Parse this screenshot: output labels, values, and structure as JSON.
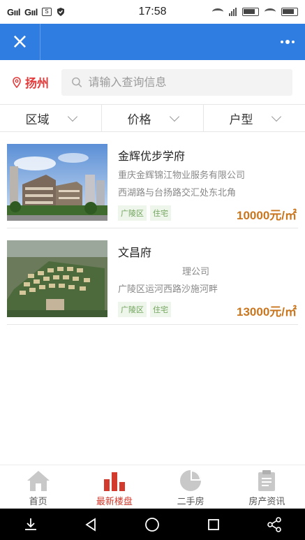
{
  "status_bar": {
    "left": "G",
    "time": "17:58"
  },
  "header": {
    "close_label": "×"
  },
  "search": {
    "city": "扬州",
    "placeholder": "请输入查询信息"
  },
  "filters": [
    {
      "label": "区域"
    },
    {
      "label": "价格"
    },
    {
      "label": "户型"
    }
  ],
  "listings": [
    {
      "title": "金辉优步学府",
      "developer": "重庆金辉锦江物业服务有限公司",
      "address": "西湖路与台扬路交汇处东北角",
      "tags": [
        "广陵区",
        "住宅"
      ],
      "price": "10000元/㎡"
    },
    {
      "title": "文昌府",
      "developer": "理公司",
      "address": "广陵区运河西路沙施河畔",
      "tags": [
        "广陵区",
        "住宅"
      ],
      "price": "13000元/㎡"
    }
  ],
  "tabbar": {
    "items": [
      {
        "label": "首页",
        "icon": "home-icon"
      },
      {
        "label": "最新楼盘",
        "icon": "bar-chart-icon"
      },
      {
        "label": "二手房",
        "icon": "pie-chart-icon"
      },
      {
        "label": "房产资讯",
        "icon": "clipboard-icon"
      }
    ],
    "active_index": 1
  },
  "colors": {
    "header_blue": "#2f7de1",
    "city_red": "#e23b3b",
    "price_orange": "#c9761f",
    "tab_active": "#d23a2d",
    "tag_green": "#6fa35b"
  }
}
